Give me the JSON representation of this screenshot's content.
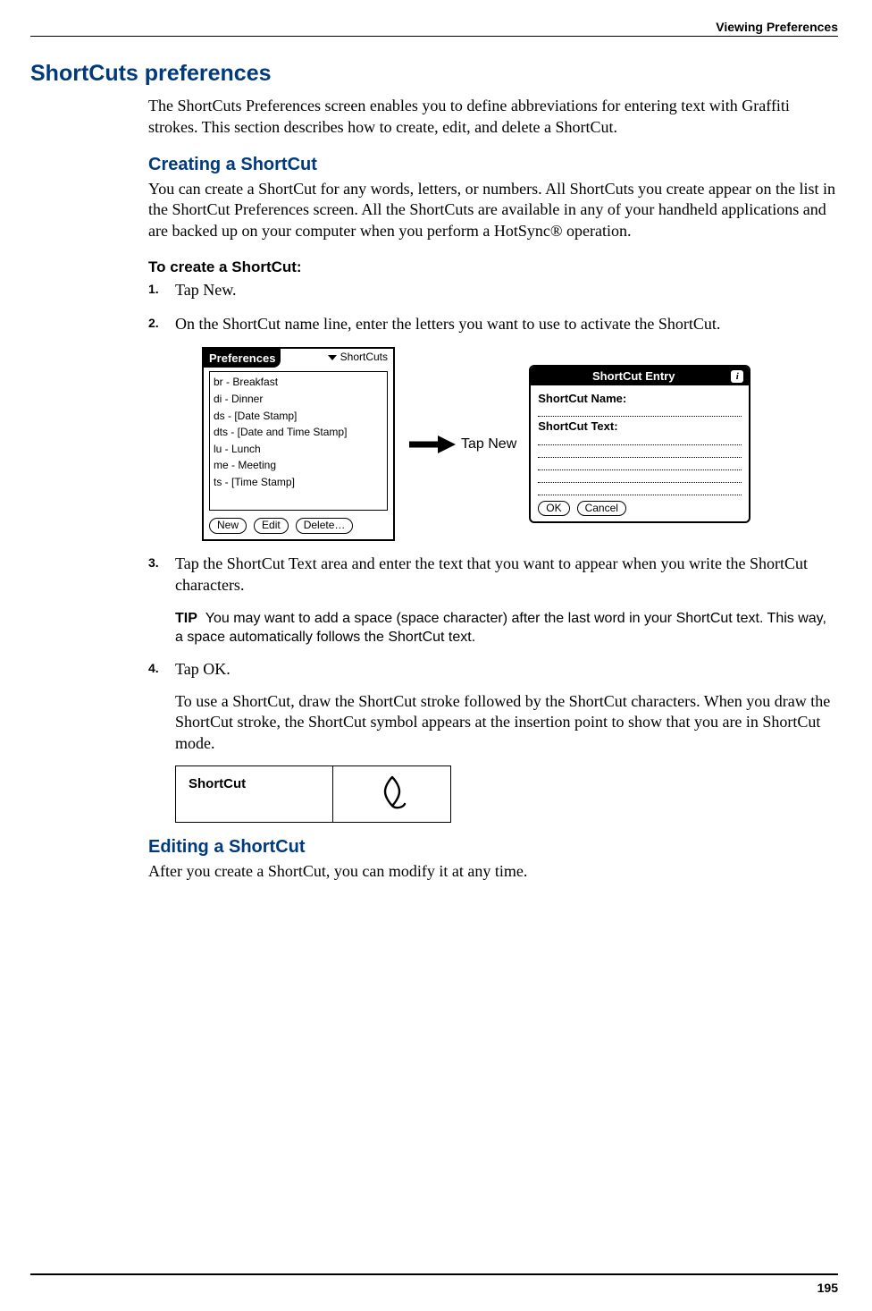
{
  "header": {
    "breadcrumb": "Viewing Preferences"
  },
  "h1": "ShortCuts preferences",
  "intro": "The ShortCuts Preferences screen enables you to define abbreviations for entering text with Graffiti strokes. This section describes how to create, edit, and delete a ShortCut.",
  "creating": {
    "heading": "Creating a ShortCut",
    "p": "You can create a ShortCut for any words, letters, or numbers. All ShortCuts you create appear on the list in the ShortCut Preferences screen. All the ShortCuts are available in any of your handheld applications and are backed up on your computer when you perform a HotSync® operation.",
    "procedure_heading": "To create a ShortCut:",
    "steps": [
      "Tap New.",
      "On the ShortCut name line, enter the letters you want to use to activate the ShortCut.",
      "Tap the ShortCut Text area and enter the text that you want to appear when you write the ShortCut characters.",
      "Tap OK."
    ],
    "tip_label": "TIP",
    "tip_text": "You may want to add a space (space character) after the last word in your ShortCut text. This way, a space automatically follows the ShortCut text.",
    "followup": "To use a ShortCut, draw the ShortCut stroke followed by the ShortCut characters. When you draw the ShortCut stroke, the ShortCut symbol appears at the insertion point to show that you are in ShortCut mode."
  },
  "figure": {
    "prefs_title": "Preferences",
    "prefs_dropdown": "ShortCuts",
    "list_items": [
      "br - Breakfast",
      "di - Dinner",
      "ds - [Date Stamp]",
      "dts - [Date and Time Stamp]",
      "lu - Lunch",
      "me - Meeting",
      "ts - [Time Stamp]"
    ],
    "btn_new": "New",
    "btn_edit": "Edit",
    "btn_delete": "Delete…",
    "tap_new_label": "Tap New",
    "entry_title": "ShortCut Entry",
    "entry_name_label": "ShortCut Name:",
    "entry_text_label": "ShortCut Text:",
    "btn_ok": "OK",
    "btn_cancel": "Cancel"
  },
  "shortcut_table": {
    "label": "ShortCut"
  },
  "editing": {
    "heading": "Editing a ShortCut",
    "p": "After you create a ShortCut, you can modify it at any time."
  },
  "page_number": "195"
}
